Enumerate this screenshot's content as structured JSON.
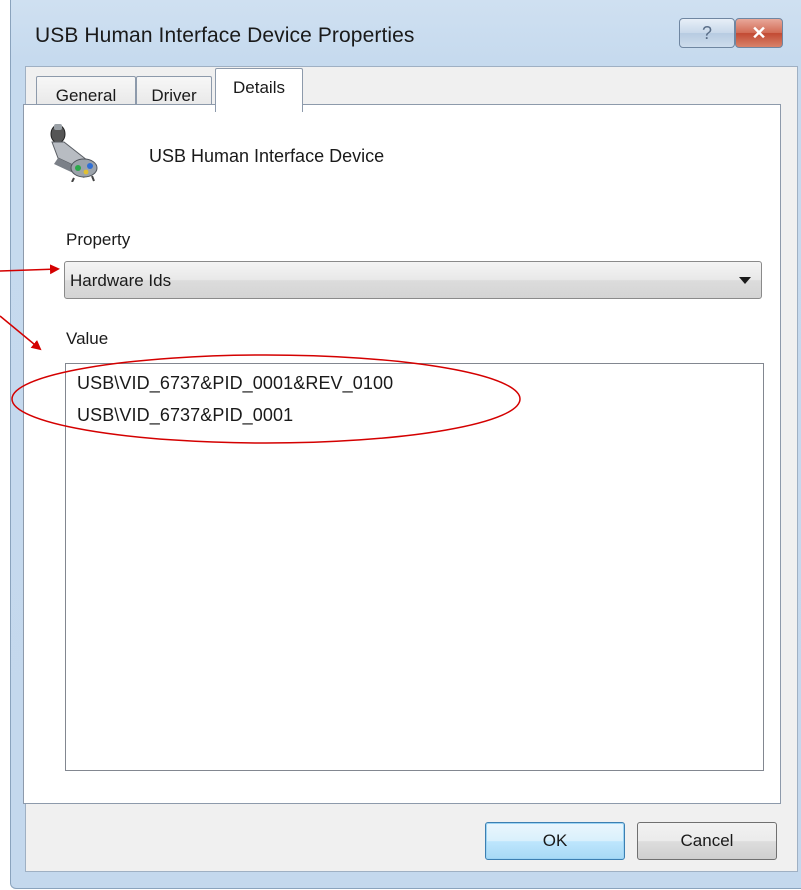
{
  "window": {
    "title": "USB Human Interface Device Properties",
    "help_label": "?",
    "close_label": "✕",
    "close_color": "#c24a33"
  },
  "tabs": [
    {
      "label": "General",
      "active": false
    },
    {
      "label": "Driver",
      "active": false
    },
    {
      "label": "Details",
      "active": true
    }
  ],
  "device": {
    "name": "USB Human Interface Device",
    "icon": "game-controller-icon"
  },
  "property": {
    "label": "Property",
    "selected": "Hardware Ids"
  },
  "value": {
    "label": "Value",
    "items": [
      "USB\\VID_6737&PID_0001&REV_0100",
      "USB\\VID_6737&PID_0001"
    ]
  },
  "buttons": {
    "ok": "OK",
    "cancel": "Cancel"
  },
  "annotation": {
    "color": "#d40000"
  }
}
